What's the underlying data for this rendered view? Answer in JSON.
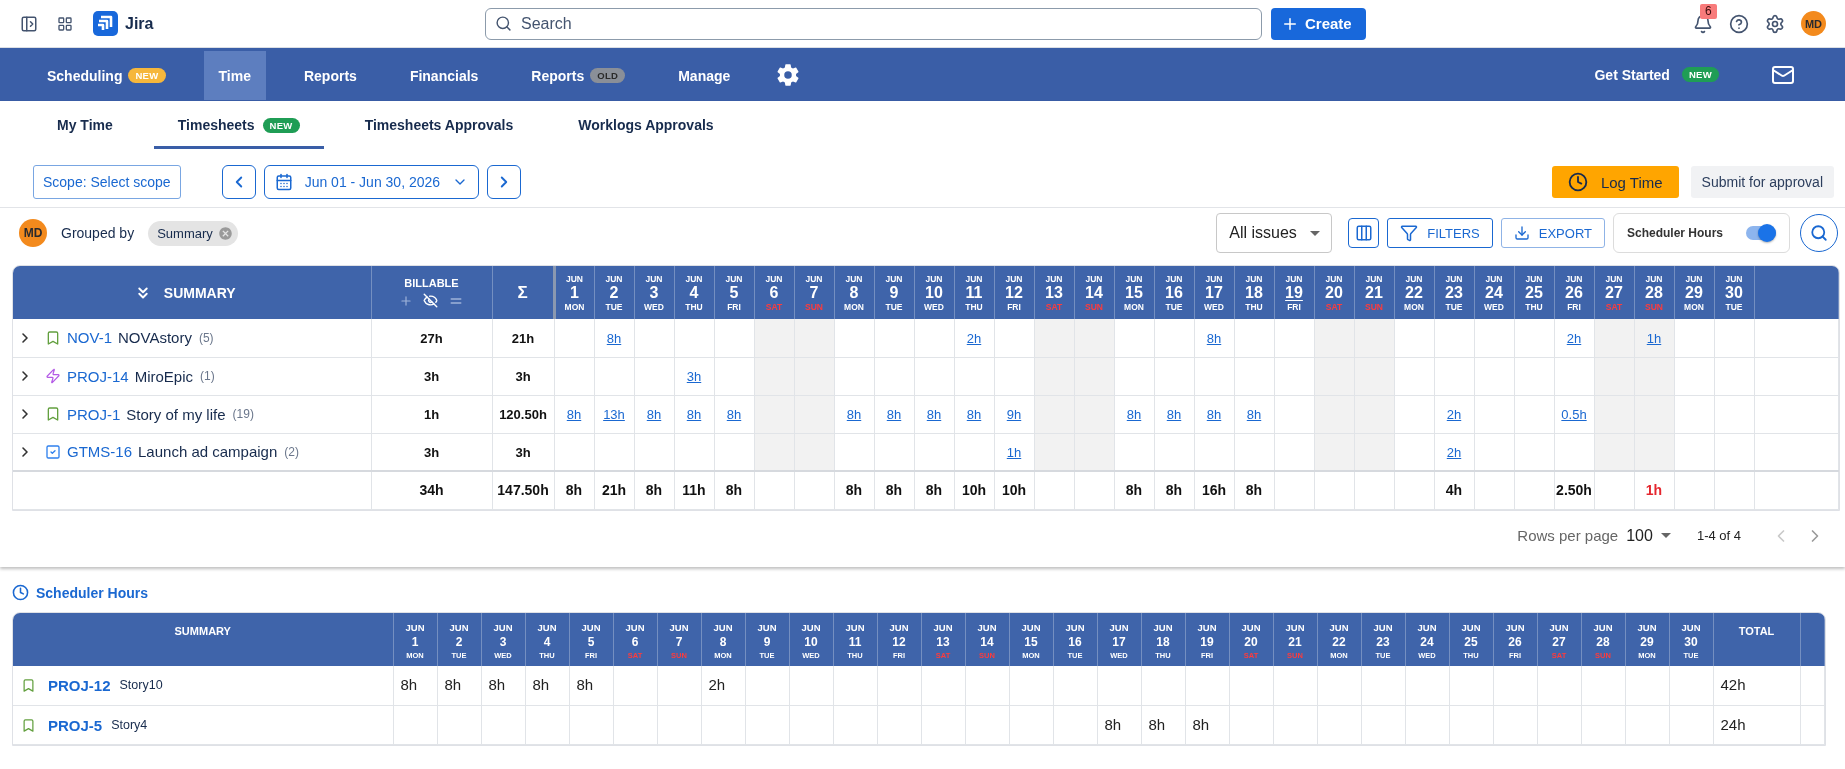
{
  "topbar": {
    "product": "Jira",
    "search": {
      "placeholder": "Search"
    },
    "create_button": "Create",
    "notifications": "6",
    "avatar": "MD"
  },
  "nav": {
    "items": [
      {
        "label": "Scheduling",
        "selected": false,
        "badge": {
          "text": "NEW",
          "kind": "new",
          "color": "#f6b73c"
        }
      },
      {
        "label": "Time",
        "selected": true
      },
      {
        "label": "Reports",
        "selected": false
      },
      {
        "label": "Financials",
        "selected": false
      },
      {
        "label": "Reports",
        "selected": false,
        "badge": {
          "text": "OLD",
          "kind": "old",
          "color": "#8a8f98"
        }
      },
      {
        "label": "Manage",
        "selected": false
      }
    ],
    "get_started": {
      "label": "Get Started",
      "badge": {
        "text": "NEW",
        "kind": "new",
        "color": "#1f9d55"
      }
    }
  },
  "subtabs": [
    {
      "label": "My Time",
      "selected": false
    },
    {
      "label": "Timesheets",
      "selected": true,
      "badge": {
        "text": "NEW",
        "kind": "new",
        "color": "#1f9d55"
      }
    },
    {
      "label": "Timesheets Approvals",
      "selected": false
    },
    {
      "label": "Worklogs Approvals",
      "selected": false
    }
  ],
  "toolbar": {
    "scope_button": "Scope: Select scope",
    "date_range": "Jun 01 - Jun 30, 2026",
    "log_time_button": "Log Time",
    "submit_button": "Submit for approval"
  },
  "grouping": {
    "avatar": "MD",
    "label": "Grouped by",
    "chip": "Summary",
    "issues_select": "All issues",
    "filters_button": "FILTERS",
    "export_button": "EXPORT",
    "scheduler_toggle": {
      "label": "Scheduler Hours",
      "on": true
    }
  },
  "timesheet": {
    "columns": {
      "summary": "SUMMARY",
      "billable": "BILLABLE",
      "total": "Σ"
    },
    "days": [
      {
        "month": "JUN",
        "day": "1",
        "weekday": "MON",
        "weekend": false,
        "today": false
      },
      {
        "month": "JUN",
        "day": "2",
        "weekday": "TUE",
        "weekend": false,
        "today": false
      },
      {
        "month": "JUN",
        "day": "3",
        "weekday": "WED",
        "weekend": false,
        "today": false
      },
      {
        "month": "JUN",
        "day": "4",
        "weekday": "THU",
        "weekend": false,
        "today": false
      },
      {
        "month": "JUN",
        "day": "5",
        "weekday": "FRI",
        "weekend": false,
        "today": false
      },
      {
        "month": "JUN",
        "day": "6",
        "weekday": "SAT",
        "weekend": true,
        "today": false
      },
      {
        "month": "JUN",
        "day": "7",
        "weekday": "SUN",
        "weekend": true,
        "today": false
      },
      {
        "month": "JUN",
        "day": "8",
        "weekday": "MON",
        "weekend": false,
        "today": false
      },
      {
        "month": "JUN",
        "day": "9",
        "weekday": "TUE",
        "weekend": false,
        "today": false
      },
      {
        "month": "JUN",
        "day": "10",
        "weekday": "WED",
        "weekend": false,
        "today": false
      },
      {
        "month": "JUN",
        "day": "11",
        "weekday": "THU",
        "weekend": false,
        "today": false
      },
      {
        "month": "JUN",
        "day": "12",
        "weekday": "FRI",
        "weekend": false,
        "today": false
      },
      {
        "month": "JUN",
        "day": "13",
        "weekday": "SAT",
        "weekend": true,
        "today": false
      },
      {
        "month": "JUN",
        "day": "14",
        "weekday": "SUN",
        "weekend": true,
        "today": false
      },
      {
        "month": "JUN",
        "day": "15",
        "weekday": "MON",
        "weekend": false,
        "today": false
      },
      {
        "month": "JUN",
        "day": "16",
        "weekday": "TUE",
        "weekend": false,
        "today": false
      },
      {
        "month": "JUN",
        "day": "17",
        "weekday": "WED",
        "weekend": false,
        "today": false
      },
      {
        "month": "JUN",
        "day": "18",
        "weekday": "THU",
        "weekend": false,
        "today": false
      },
      {
        "month": "JUN",
        "day": "19",
        "weekday": "FRI",
        "weekend": false,
        "today": true
      },
      {
        "month": "JUN",
        "day": "20",
        "weekday": "SAT",
        "weekend": true,
        "today": false
      },
      {
        "month": "JUN",
        "day": "21",
        "weekday": "SUN",
        "weekend": true,
        "today": false
      },
      {
        "month": "JUN",
        "day": "22",
        "weekday": "MON",
        "weekend": false,
        "today": false
      },
      {
        "month": "JUN",
        "day": "23",
        "weekday": "TUE",
        "weekend": false,
        "today": false
      },
      {
        "month": "JUN",
        "day": "24",
        "weekday": "WED",
        "weekend": false,
        "today": false
      },
      {
        "month": "JUN",
        "day": "25",
        "weekday": "THU",
        "weekend": false,
        "today": false
      },
      {
        "month": "JUN",
        "day": "26",
        "weekday": "FRI",
        "weekend": false,
        "today": false
      },
      {
        "month": "JUN",
        "day": "27",
        "weekday": "SAT",
        "weekend": true,
        "today": false
      },
      {
        "month": "JUN",
        "day": "28",
        "weekday": "SUN",
        "weekend": true,
        "today": false
      },
      {
        "month": "JUN",
        "day": "29",
        "weekday": "MON",
        "weekend": false,
        "today": false
      },
      {
        "month": "JUN",
        "day": "30",
        "weekday": "TUE",
        "weekend": false,
        "today": false
      }
    ],
    "rows": [
      {
        "kind": "story",
        "key": "NOV-1",
        "title": "NOVAstory",
        "count": "(5)",
        "billable": "27h",
        "total": "21h",
        "cells": [
          null,
          "8h",
          null,
          null,
          null,
          null,
          null,
          null,
          null,
          null,
          "2h",
          null,
          null,
          null,
          null,
          null,
          "8h",
          null,
          null,
          null,
          null,
          null,
          null,
          null,
          null,
          "2h",
          null,
          "1h",
          null,
          null
        ]
      },
      {
        "kind": "epic",
        "key": "PROJ-14",
        "title": "MiroEpic",
        "count": "(1)",
        "billable": "3h",
        "total": "3h",
        "cells": [
          null,
          null,
          null,
          "3h",
          null,
          null,
          null,
          null,
          null,
          null,
          null,
          null,
          null,
          null,
          null,
          null,
          null,
          null,
          null,
          null,
          null,
          null,
          null,
          null,
          null,
          null,
          null,
          null,
          null,
          null
        ]
      },
      {
        "kind": "story",
        "key": "PROJ-1",
        "title": "Story of my life",
        "count": "(19)",
        "billable": "1h",
        "total": "120.50h",
        "cells": [
          "8h",
          "13h",
          "8h",
          "8h",
          "8h",
          null,
          null,
          "8h",
          "8h",
          "8h",
          "8h",
          "9h",
          null,
          null,
          "8h",
          "8h",
          "8h",
          "8h",
          null,
          null,
          null,
          null,
          "2h",
          null,
          null,
          "0.5h",
          null,
          null,
          null,
          null
        ]
      },
      {
        "kind": "task",
        "key": "GTMS-16",
        "title": "Launch ad campaign",
        "count": "(2)",
        "billable": "3h",
        "total": "3h",
        "cells": [
          null,
          null,
          null,
          null,
          null,
          null,
          null,
          null,
          null,
          null,
          null,
          "1h",
          null,
          null,
          null,
          null,
          null,
          null,
          null,
          null,
          null,
          null,
          "2h",
          null,
          null,
          null,
          null,
          null,
          null,
          null
        ]
      }
    ],
    "totals": {
      "billable": "34h",
      "total": "147.50h",
      "cells": [
        "8h",
        "21h",
        "8h",
        "11h",
        "8h",
        null,
        null,
        "8h",
        "8h",
        "8h",
        "10h",
        "10h",
        null,
        null,
        "8h",
        "8h",
        "16h",
        "8h",
        null,
        null,
        null,
        null,
        "4h",
        null,
        null,
        "2.50h",
        null,
        "1h",
        null,
        null
      ]
    }
  },
  "pagination": {
    "label": "Rows per page",
    "rows_per_page": "100",
    "range": "1-4 of 4",
    "prev_disabled": true,
    "next_disabled": false
  },
  "scheduler": {
    "title": "Scheduler Hours",
    "columns": {
      "summary": "SUMMARY",
      "total": "TOTAL"
    },
    "days": [
      {
        "month": "JUN",
        "day": "1",
        "weekday": "MON",
        "weekend": false
      },
      {
        "month": "JUN",
        "day": "2",
        "weekday": "TUE",
        "weekend": false
      },
      {
        "month": "JUN",
        "day": "3",
        "weekday": "WED",
        "weekend": false
      },
      {
        "month": "JUN",
        "day": "4",
        "weekday": "THU",
        "weekend": false
      },
      {
        "month": "JUN",
        "day": "5",
        "weekday": "FRI",
        "weekend": false
      },
      {
        "month": "JUN",
        "day": "6",
        "weekday": "SAT",
        "weekend": true
      },
      {
        "month": "JUN",
        "day": "7",
        "weekday": "SUN",
        "weekend": true
      },
      {
        "month": "JUN",
        "day": "8",
        "weekday": "MON",
        "weekend": false
      },
      {
        "month": "JUN",
        "day": "9",
        "weekday": "TUE",
        "weekend": false
      },
      {
        "month": "JUN",
        "day": "10",
        "weekday": "WED",
        "weekend": false
      },
      {
        "month": "JUN",
        "day": "11",
        "weekday": "THU",
        "weekend": false
      },
      {
        "month": "JUN",
        "day": "12",
        "weekday": "FRI",
        "weekend": false
      },
      {
        "month": "JUN",
        "day": "13",
        "weekday": "SAT",
        "weekend": true
      },
      {
        "month": "JUN",
        "day": "14",
        "weekday": "SUN",
        "weekend": true
      },
      {
        "month": "JUN",
        "day": "15",
        "weekday": "MON",
        "weekend": false
      },
      {
        "month": "JUN",
        "day": "16",
        "weekday": "TUE",
        "weekend": false
      },
      {
        "month": "JUN",
        "day": "17",
        "weekday": "WED",
        "weekend": false
      },
      {
        "month": "JUN",
        "day": "18",
        "weekday": "THU",
        "weekend": false
      },
      {
        "month": "JUN",
        "day": "19",
        "weekday": "FRI",
        "weekend": false
      },
      {
        "month": "JUN",
        "day": "20",
        "weekday": "SAT",
        "weekend": true
      },
      {
        "month": "JUN",
        "day": "21",
        "weekday": "SUN",
        "weekend": true
      },
      {
        "month": "JUN",
        "day": "22",
        "weekday": "MON",
        "weekend": false
      },
      {
        "month": "JUN",
        "day": "23",
        "weekday": "TUE",
        "weekend": false
      },
      {
        "month": "JUN",
        "day": "24",
        "weekday": "WED",
        "weekend": false
      },
      {
        "month": "JUN",
        "day": "25",
        "weekday": "THU",
        "weekend": false
      },
      {
        "month": "JUN",
        "day": "26",
        "weekday": "FRI",
        "weekend": false
      },
      {
        "month": "JUN",
        "day": "27",
        "weekday": "SAT",
        "weekend": true
      },
      {
        "month": "JUN",
        "day": "28",
        "weekday": "SUN",
        "weekend": true
      },
      {
        "month": "JUN",
        "day": "29",
        "weekday": "MON",
        "weekend": false
      },
      {
        "month": "JUN",
        "day": "30",
        "weekday": "TUE",
        "weekend": false
      }
    ],
    "rows": [
      {
        "kind": "story",
        "key": "PROJ-12",
        "title": "Story10",
        "total": "42h",
        "cells": [
          "8h",
          "8h",
          "8h",
          "8h",
          "8h",
          null,
          null,
          "2h",
          null,
          null,
          null,
          null,
          null,
          null,
          null,
          null,
          null,
          null,
          null,
          null,
          null,
          null,
          null,
          null,
          null,
          null,
          null,
          null,
          null,
          null
        ]
      },
      {
        "kind": "story",
        "key": "PROJ-5",
        "title": "Story4",
        "total": "24h",
        "cells": [
          null,
          null,
          null,
          null,
          null,
          null,
          null,
          null,
          null,
          null,
          null,
          null,
          null,
          null,
          null,
          null,
          "8h",
          "8h",
          "8h",
          null,
          null,
          null,
          null,
          null,
          null,
          null,
          null,
          null,
          null,
          null
        ]
      }
    ]
  }
}
